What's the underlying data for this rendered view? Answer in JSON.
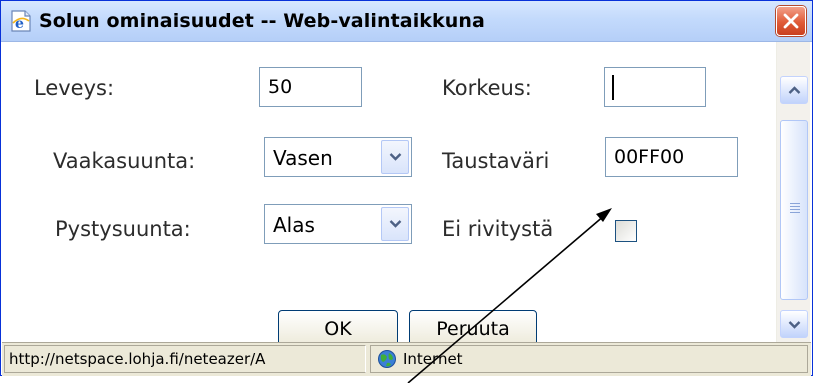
{
  "window": {
    "title": "Solun ominaisuudet -- Web-valintaikkuna"
  },
  "form": {
    "width_label": "Leveys:",
    "width_value": "50",
    "height_label": "Korkeus:",
    "height_value": "",
    "halign_label": "Vaakasuunta:",
    "halign_value": "Vasen",
    "bgcolor_label": "Taustaväri",
    "bgcolor_value": "00FF00",
    "valign_label": "Pystysuunta:",
    "valign_value": "Alas",
    "nowrap_label": "Ei rivitystä",
    "nowrap_checked": false
  },
  "buttons": {
    "ok_label": "OK",
    "cancel_label": "Peruuta"
  },
  "statusbar": {
    "url": "http://netspace.lohja.fi/neteazer/A",
    "zone": "Internet"
  },
  "icons": {
    "title": "ie-page-icon",
    "close": "close-icon",
    "dropdown": "chevron-down-icon",
    "zone": "globe-icon"
  },
  "colors": {
    "titlebar": "#c3dafc",
    "close_button": "#e05b38",
    "input_border": "#7f9db9",
    "statusbar": "#ece9d8",
    "annotation_arrow": "#000000"
  }
}
